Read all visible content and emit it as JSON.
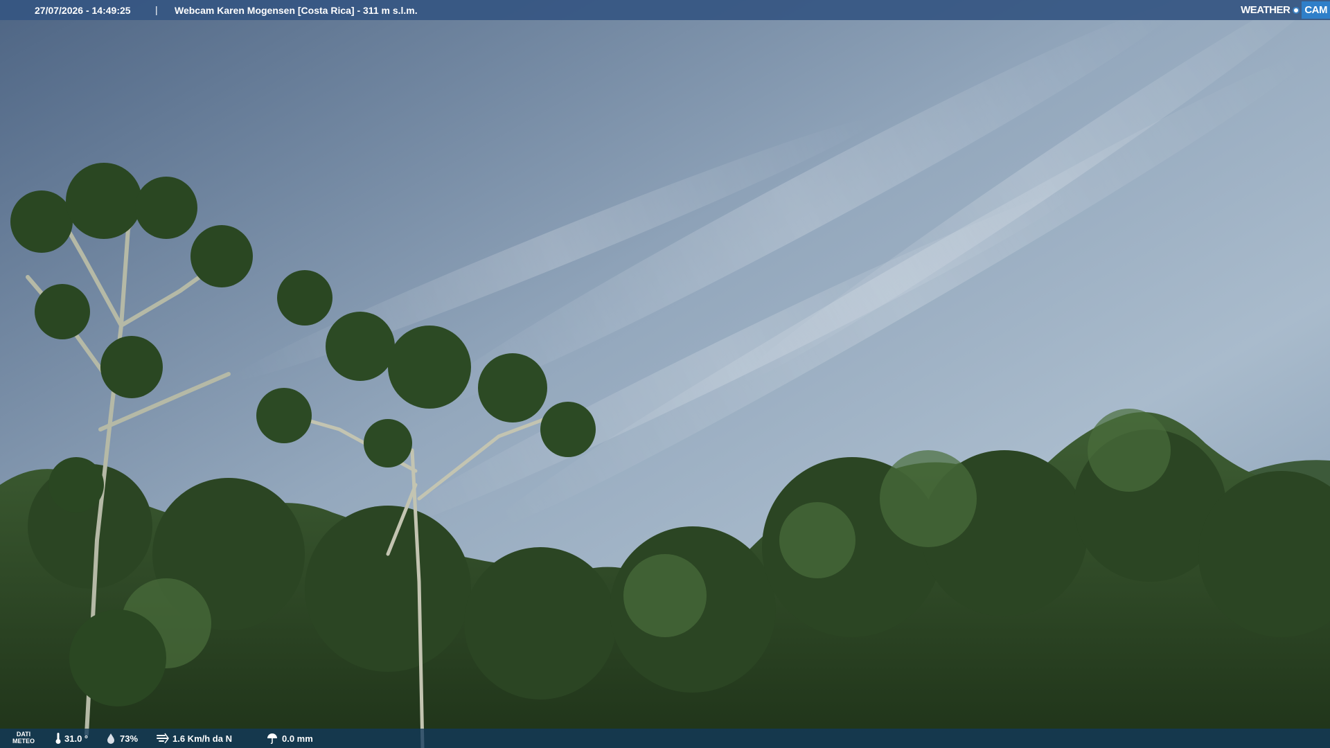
{
  "header": {
    "datetime": "27/07/2026 - 14:49:25",
    "separator": "|",
    "title": "Webcam Karen Mogensen [Costa Rica] - 311 m s.l.m."
  },
  "brand": {
    "weather": "WEATHER",
    "cam": "CAM"
  },
  "footer": {
    "dati_line1": "DATI",
    "dati_line2": "METEO",
    "temperature": "31.0 °",
    "humidity": "73%",
    "wind": "1.6 Km/h da N",
    "rain": "0.0 mm"
  },
  "colors": {
    "topbar": "#355682",
    "bottombar": "#123a5c",
    "brand_accent": "#2f7fc9",
    "sky_top": "#5f7590",
    "sky_bright": "#a6b8ca",
    "foliage": "#2f4a26"
  },
  "icons": {
    "temperature": "thermometer-icon",
    "humidity": "humidity-drop-icon",
    "wind": "wind-icon",
    "rain": "rain-icon"
  }
}
